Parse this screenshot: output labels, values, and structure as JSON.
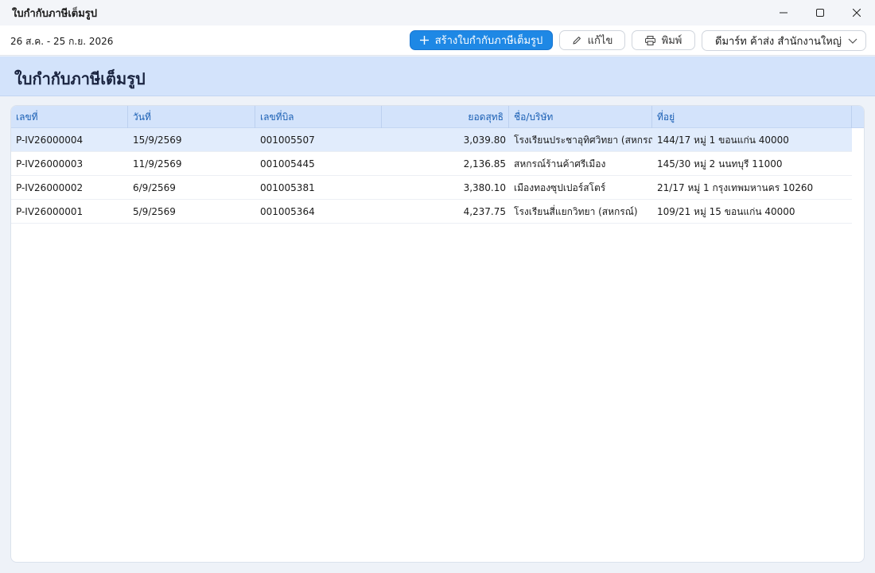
{
  "window": {
    "title": "ใบกำกับภาษีเต็มรูป"
  },
  "toolbar": {
    "date_range": "26 ส.ค. - 25 ก.ย. 2026",
    "create_label": "สร้างใบกำกับภาษีเต็มรูป",
    "edit_label": "แก้ไข",
    "print_label": "พิมพ์",
    "branch_selected": "ดีมาร์ท ค้าส่ง สำนักงานใหญ่"
  },
  "page": {
    "heading": "ใบกำกับภาษีเต็มรูป"
  },
  "table": {
    "columns": [
      "เลขที่",
      "วันที่",
      "เลขที่บิล",
      "ยอดสุทธิ",
      "ชื่อ/บริษัท",
      "ที่อยู่"
    ],
    "rows": [
      {
        "no": "P-IV26000004",
        "date": "15/9/2569",
        "bill": "001005507",
        "net": "3,039.80",
        "name": "โรงเรียนประชาอุทิศวิทยา (สหกรณ์)",
        "address": "144/17 หมู่ 1 ขอนแก่น 40000"
      },
      {
        "no": "P-IV26000003",
        "date": "11/9/2569",
        "bill": "001005445",
        "net": "2,136.85",
        "name": "สหกรณ์ร้านค้าศรีเมือง",
        "address": "145/30 หมู่ 2 นนทบุรี 11000"
      },
      {
        "no": "P-IV26000002",
        "date": "6/9/2569",
        "bill": "001005381",
        "net": "3,380.10",
        "name": "เมืองทองซุปเปอร์สโตร์",
        "address": "21/17 หมู่ 1 กรุงเทพมหานคร 10260"
      },
      {
        "no": "P-IV26000001",
        "date": "5/9/2569",
        "bill": "001005364",
        "net": "4,237.75",
        "name": "โรงเรียนสี่แยกวิทยา (สหกรณ์)",
        "address": "109/21 หมู่ 15 ขอนแก่น 40000"
      }
    ],
    "selected_row": 0
  },
  "colors": {
    "accent": "#1e88e5",
    "header_bg": "#d3e3fb",
    "selected_row": "#e1ecfc"
  }
}
